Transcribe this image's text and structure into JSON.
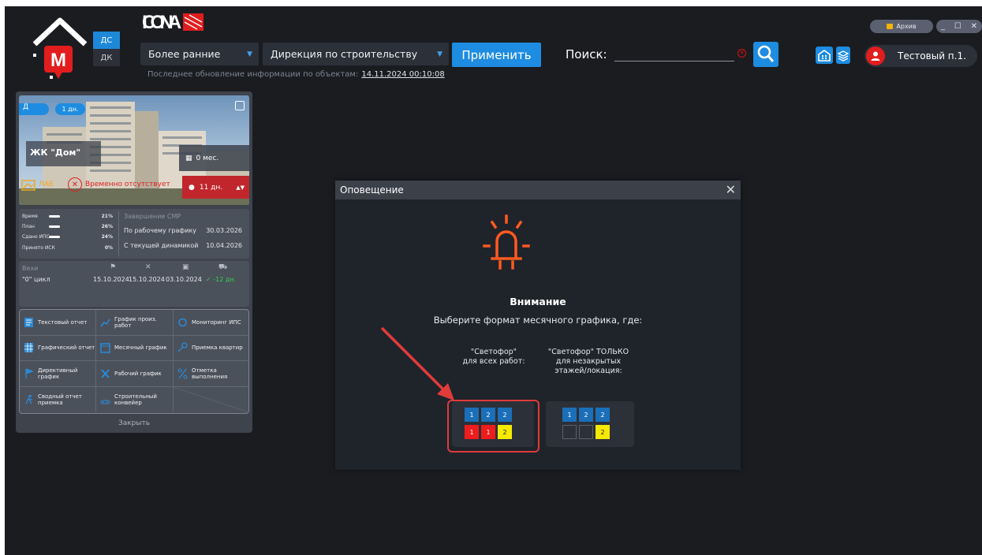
{
  "header": {
    "ds_label": "ДС",
    "dk_label": "ДК",
    "filter_period": "Более ранние",
    "filter_department": "Дирекция по строительству",
    "apply_label": "Применить",
    "search_label": "Поиск:",
    "search_value": "",
    "updated_text": "Последнее обновление информации по объектам:",
    "updated_time": "14.11.2024 00:10:08",
    "archive_label": "Архив",
    "user_name": "Тестовый п.1."
  },
  "card": {
    "tag_d": "Д",
    "tag_days": "1 дн.",
    "project_name": "ЖК \"Дом\"",
    "months": "0 мес.",
    "lab": "ЛАБ",
    "absent": "Временно отсутствует",
    "days_left": "11 дн.",
    "stats": [
      {
        "label": "Время",
        "pct": "21%"
      },
      {
        "label": "План",
        "pct": "26%"
      },
      {
        "label": "Сдано ИПС",
        "pct": "24%"
      },
      {
        "label": "Принято ИСК",
        "pct": "0%"
      }
    ],
    "smr_header": "Завершение СМР",
    "smr_rows": [
      {
        "label": "По рабочему графику",
        "date": "30.03.2026"
      },
      {
        "label": "С текущей динамикой",
        "date": "10.04.2026"
      }
    ],
    "milestones_header": "Вехи",
    "milestone_name": "\"0\" цикл",
    "milestone_dates": [
      "15.10.2024",
      "15.10.2024",
      "03.10.2024"
    ],
    "milestone_delta": "✓ -12 дн.",
    "menu": [
      "Текстовый отчет",
      "График произ. работ",
      "Мониторинг ИПС",
      "Графический отчет",
      "Месячный график",
      "Приемка квартир",
      "Директивный график",
      "Рабочий график",
      "Отметка выполнения",
      "Сводный отчет приемка",
      "Строительный конвейер",
      ""
    ],
    "close_label": "Закрыть"
  },
  "dialog": {
    "title": "Оповещение",
    "heading": "Внимание",
    "subtitle": "Выберите формат месячного графика, где:",
    "option1_label": "\"Светофор\"\nдля всех работ:",
    "option2_label": "\"Светофор\" ТОЛЬКО\nдля незакрытых\nэтажей/локация:",
    "option1_top": [
      "1",
      "2",
      "2"
    ],
    "option1_bottom": [
      "1",
      "1",
      "2"
    ],
    "option2_top": [
      "1",
      "2",
      "2"
    ],
    "option2_bottom": [
      "",
      "",
      "2"
    ]
  },
  "colors": {
    "accent": "#1e8ce0",
    "alert": "#ee1c1c",
    "warning": "#f5ea00",
    "bell": "#ff5a1f"
  }
}
